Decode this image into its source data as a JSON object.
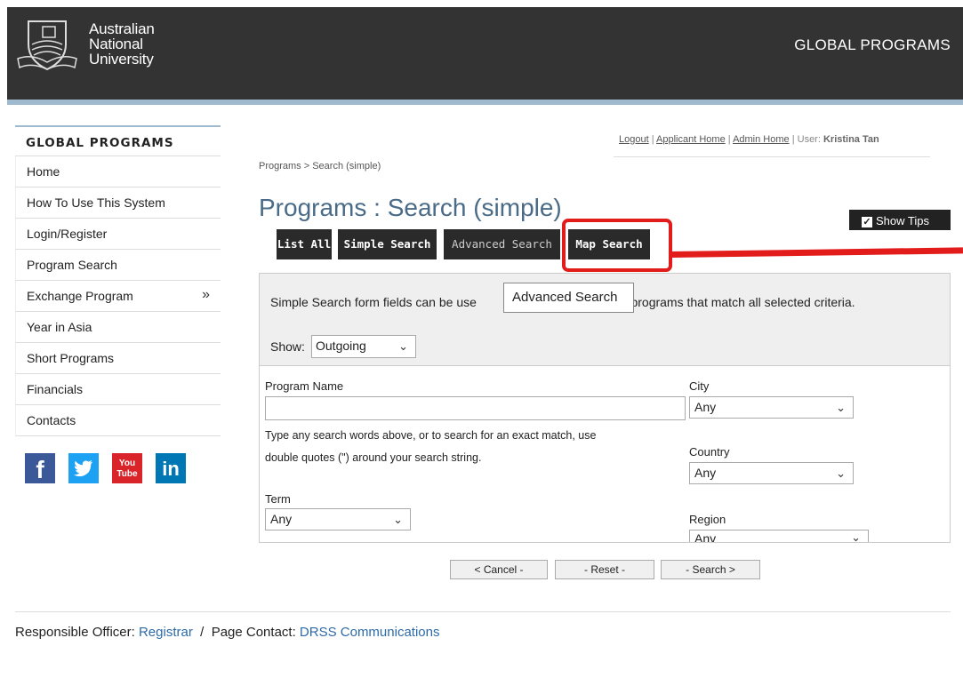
{
  "header": {
    "university_lines": [
      "Australian",
      "National",
      "University"
    ],
    "title": "GLOBAL PROGRAMS"
  },
  "sidebar": {
    "title": "GLOBAL PROGRAMS",
    "items": [
      {
        "label": "Home"
      },
      {
        "label": "How To Use This System"
      },
      {
        "label": "Login/Register"
      },
      {
        "label": "Program Search"
      },
      {
        "label": "Exchange Program",
        "suffix": "»"
      },
      {
        "label": "Year in Asia"
      },
      {
        "label": "Short Programs"
      },
      {
        "label": "Financials"
      },
      {
        "label": "Contacts"
      }
    ],
    "social": [
      {
        "icon": "facebook-icon",
        "glyph": "f"
      },
      {
        "icon": "twitter-icon",
        "glyph": "🐦"
      },
      {
        "icon": "youtube-icon",
        "glyph": "You Tube"
      },
      {
        "icon": "linkedin-icon",
        "glyph": "in"
      }
    ]
  },
  "toplinks": {
    "logout": "Logout",
    "applicant_home": "Applicant Home",
    "admin_home": "Admin Home",
    "user_label": "User:",
    "user_name": "Kristina Tan",
    "sep": "|"
  },
  "breadcrumb": "Programs > Search (simple)",
  "page_title": "Programs : Search (simple)",
  "show_tips": "Show Tips",
  "tabs": {
    "list_all": "List All",
    "simple": "Simple Search",
    "advanced": "Advanced Search",
    "map": "Map Search"
  },
  "tooltip": "Advanced Search",
  "form": {
    "intro_before": "Simple Search form fields can be use",
    "intro_after": "ind programs that match all selected criteria.",
    "show_label": "Show:",
    "show_value": "Outgoing",
    "program_name_label": "Program Name",
    "program_name_value": "",
    "help_line1": "Type any search words above, or to search for an exact match, use",
    "help_line2": "double quotes (\") around your search string.",
    "term_label": "Term",
    "term_value": "Any",
    "city_label": "City",
    "city_value": "Any",
    "country_label": "Country",
    "country_value": "Any",
    "region_label": "Region",
    "region_value": "Any"
  },
  "buttons": {
    "cancel": "< Cancel -",
    "reset": "- Reset -",
    "search": "- Search >"
  },
  "footer": {
    "officer_label": "Responsible Officer:",
    "officer_link": "Registrar",
    "slash": "/",
    "contact_label": "Page Contact:",
    "contact_link": "DRSS Communications"
  },
  "colors": {
    "header_bg": "#333333",
    "accent_blue": "#4a6b88",
    "highlight_red": "#e21b1b",
    "link_blue": "#2d6aa8"
  }
}
